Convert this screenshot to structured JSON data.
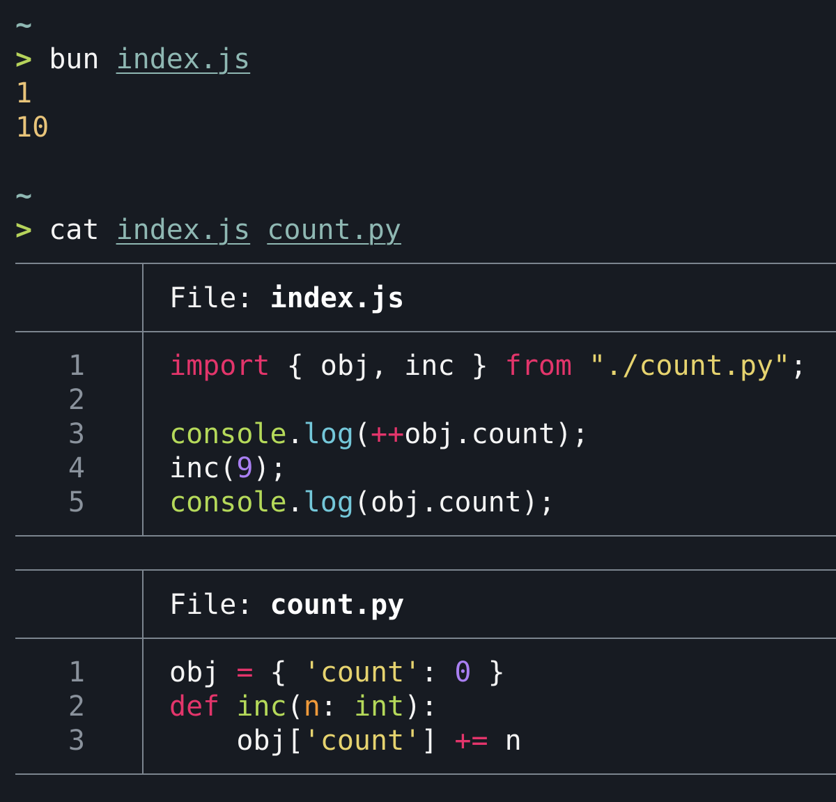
{
  "terminal": {
    "prompt_home": "~",
    "prompt_arrow": ">",
    "cmd1": {
      "program": "bun",
      "args": [
        "index.js"
      ]
    },
    "output1": [
      "1",
      "10"
    ],
    "cmd2": {
      "program": "cat",
      "args": [
        "index.js",
        "count.py"
      ]
    }
  },
  "files": [
    {
      "label": "File:",
      "name": "index.js",
      "line_numbers": [
        "1",
        "2",
        "3",
        "4",
        "5"
      ],
      "lines": [
        "import { obj, inc } from \"./count.py\";",
        "",
        "console.log(++obj.count);",
        "inc(9);",
        "console.log(obj.count);"
      ]
    },
    {
      "label": "File:",
      "name": "count.py",
      "line_numbers": [
        "1",
        "2",
        "3"
      ],
      "lines": [
        "obj = { 'count': 0 }",
        "def inc(n: int):",
        "    obj['count'] += n"
      ]
    }
  ],
  "syntax_colors": {
    "background": "#171b22",
    "keyword": "#e3356b",
    "string": "#e6d36f",
    "number": "#a97ff2",
    "function": "#b5d95a",
    "method": "#74c7d9",
    "parameter": "#f09a3b",
    "path": "#8fb8b3",
    "prompt_arrow": "#b6d35b",
    "output": "#e8c47a",
    "line_number": "#8a929c"
  }
}
